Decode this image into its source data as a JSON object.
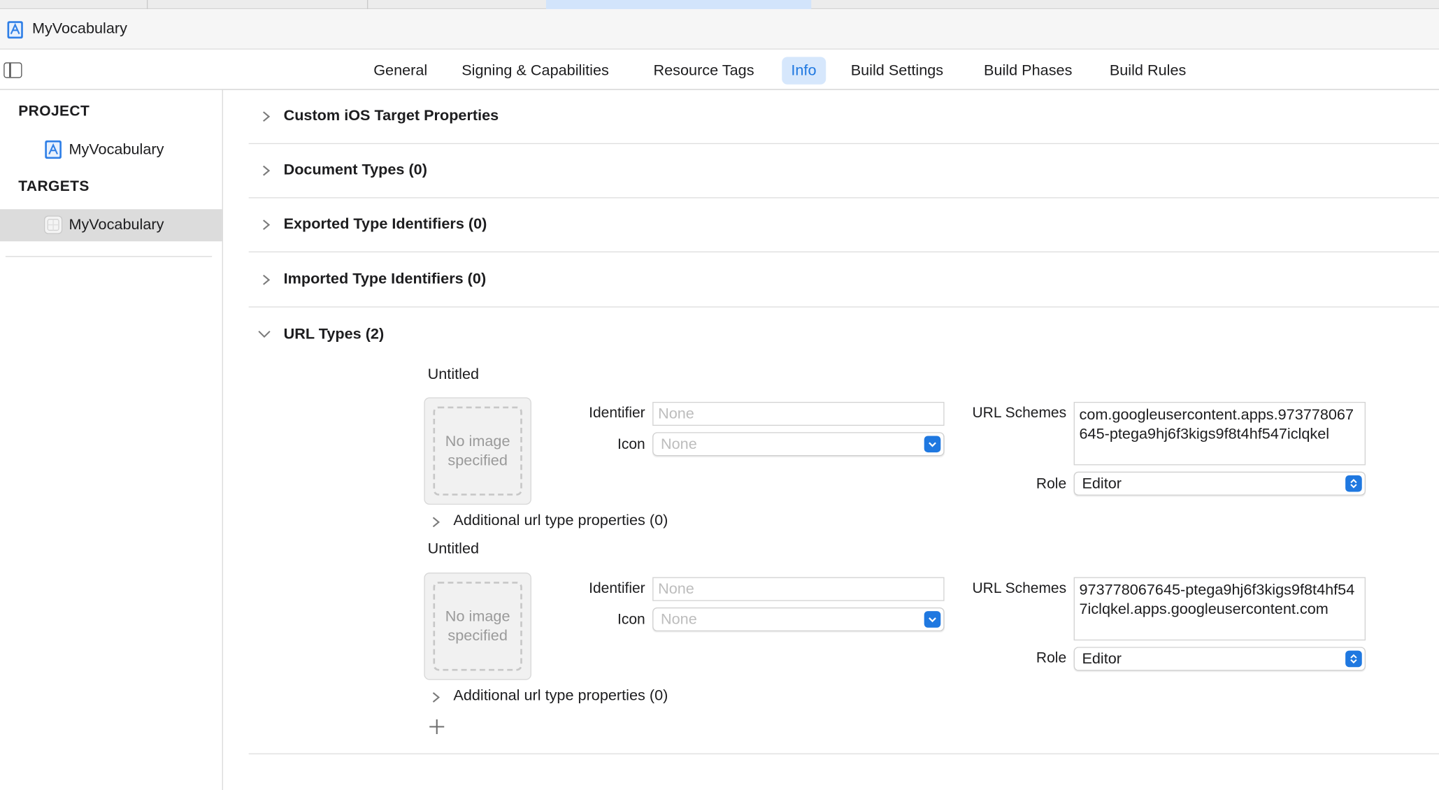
{
  "window": {
    "title": "MyVocabulary"
  },
  "editor_tabs": [
    {
      "label": "General",
      "selected": false
    },
    {
      "label": "Signing & Capabilities",
      "selected": false
    },
    {
      "label": "Resource Tags",
      "selected": false
    },
    {
      "label": "Info",
      "selected": true
    },
    {
      "label": "Build Settings",
      "selected": false
    },
    {
      "label": "Build Phases",
      "selected": false
    },
    {
      "label": "Build Rules",
      "selected": false
    }
  ],
  "sidebar": {
    "project_header": "PROJECT",
    "project_item": {
      "label": "MyVocabulary",
      "icon": "xcode-project-icon"
    },
    "targets_header": "TARGETS",
    "target_item": {
      "label": "MyVocabulary",
      "icon": "app-target-icon",
      "selected": true
    }
  },
  "sections": [
    {
      "title": "Custom iOS Target Properties",
      "expanded": false
    },
    {
      "title": "Document Types (0)",
      "expanded": false
    },
    {
      "title": "Exported Type Identifiers (0)",
      "expanded": false
    },
    {
      "title": "Imported Type Identifiers (0)",
      "expanded": false
    },
    {
      "title": "URL Types (2)",
      "expanded": true
    }
  ],
  "url_types": [
    {
      "name": "Untitled",
      "image_placeholder": "No image specified",
      "identifier_label": "Identifier",
      "identifier_placeholder": "None",
      "icon_label": "Icon",
      "icon_placeholder": "None",
      "url_schemes_label": "URL Schemes",
      "url_schemes_value": "com.googleusercontent.apps.973778067645-ptega9hj6f3kigs9f8t4hf547iclqkel",
      "role_label": "Role",
      "role_value": "Editor",
      "additional_label": "Additional url type properties (0)"
    },
    {
      "name": "Untitled",
      "image_placeholder": "No image specified",
      "identifier_label": "Identifier",
      "identifier_placeholder": "None",
      "icon_label": "Icon",
      "icon_placeholder": "None",
      "url_schemes_label": "URL Schemes",
      "url_schemes_value": "973778067645-ptega9hj6f3kigs9f8t4hf547iclqkel.apps.googleusercontent.com",
      "role_label": "Role",
      "role_value": "Editor",
      "additional_label": "Additional url type properties (0)"
    }
  ],
  "colors": {
    "accent": "#1f78e0",
    "selected_tab_bg": "#d6e7fc",
    "sidebar_selected_bg": "#dcdcdc"
  }
}
